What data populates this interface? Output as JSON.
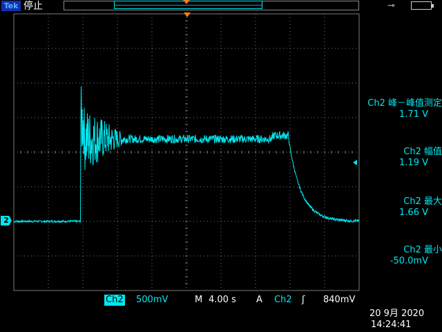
{
  "header": {
    "brand": "Tek",
    "run_status": "停止"
  },
  "icons": {
    "power": "power-plug-icon",
    "battery": "battery-icon"
  },
  "colors": {
    "ch2": "#00e8f0",
    "trigger_marker": "#ff7a1a",
    "grid": "#7a7a7a",
    "background": "#000000"
  },
  "waveform": {
    "channel_marker": "2",
    "baseline_level": -0.0,
    "high_level": 1.19
  },
  "measurements": {
    "pkpk": {
      "label": "Ch2 峰－峰值测定",
      "value": "1.71 V"
    },
    "amplitude": {
      "label": "Ch2 幅值",
      "value": "1.19 V"
    },
    "max": {
      "label": "Ch2 最大",
      "value": "1.66 V"
    },
    "min": {
      "label": "Ch2 最小",
      "value": "-50.0mV"
    }
  },
  "bottom": {
    "channel": "Ch2",
    "volts_per_div": "500mV",
    "timebase_tag": "M",
    "time_per_div": "4.00 s",
    "trigger_tag": "A",
    "trigger_source": "Ch2",
    "trigger_slope": "ʃ",
    "trigger_level": "840mV"
  },
  "datetime": {
    "date": "20 9月  2020",
    "time": "14:24:41"
  }
}
